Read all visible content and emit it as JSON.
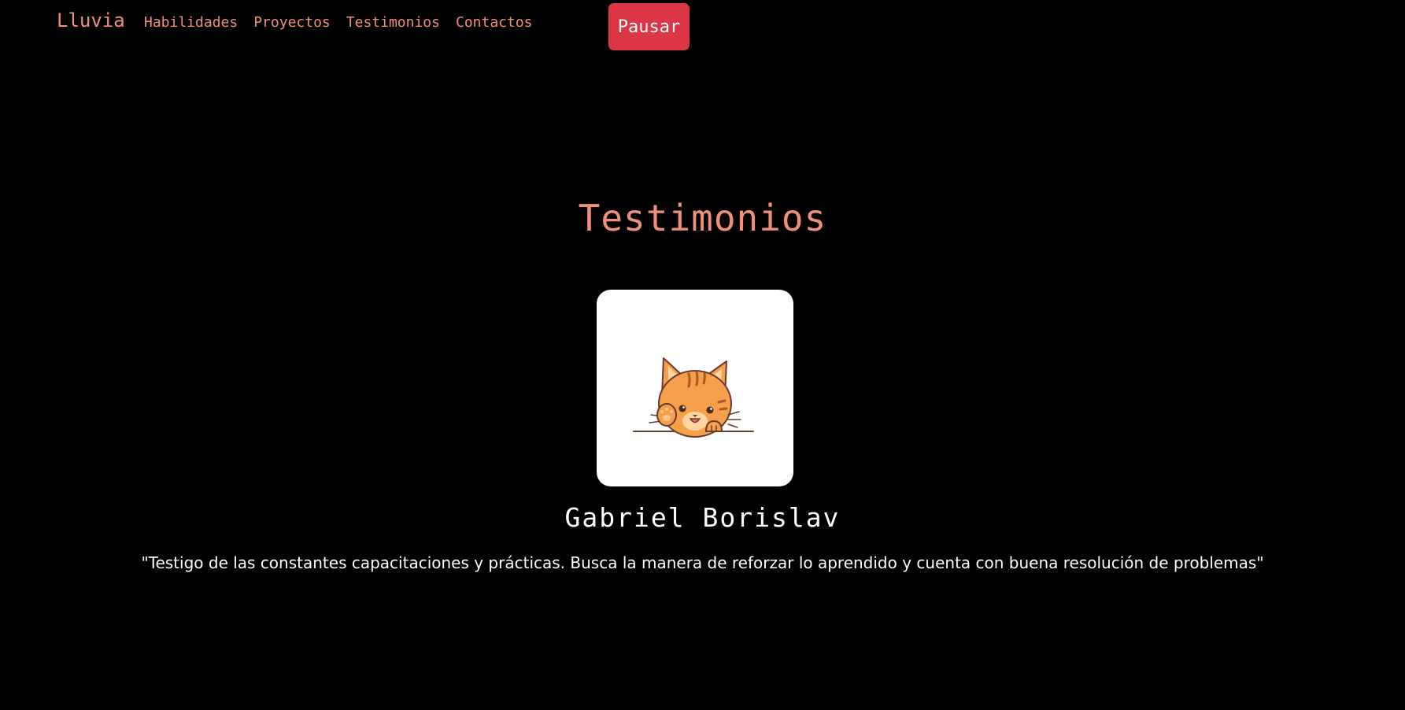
{
  "nav": {
    "brand": "Lluvia",
    "links": [
      "Habilidades",
      "Proyectos",
      "Testimonios",
      "Contactos"
    ],
    "pause_label": "Pausar"
  },
  "testimonials": {
    "title": "Testimonios",
    "items": [
      {
        "avatar_icon": "cat-waving-icon",
        "name": "Gabriel Borislav",
        "quote": "\"Testigo de las constantes capacitaciones y prácticas. Busca la manera de reforzar lo aprendido y cuenta con buena resolución de problemas\""
      }
    ]
  },
  "colors": {
    "background": "#000000",
    "accent": "#f0907a",
    "pause_button": "#dc3545",
    "text": "#ffffff",
    "card": "#ffffff",
    "cat_fur": "#f7a04b"
  }
}
